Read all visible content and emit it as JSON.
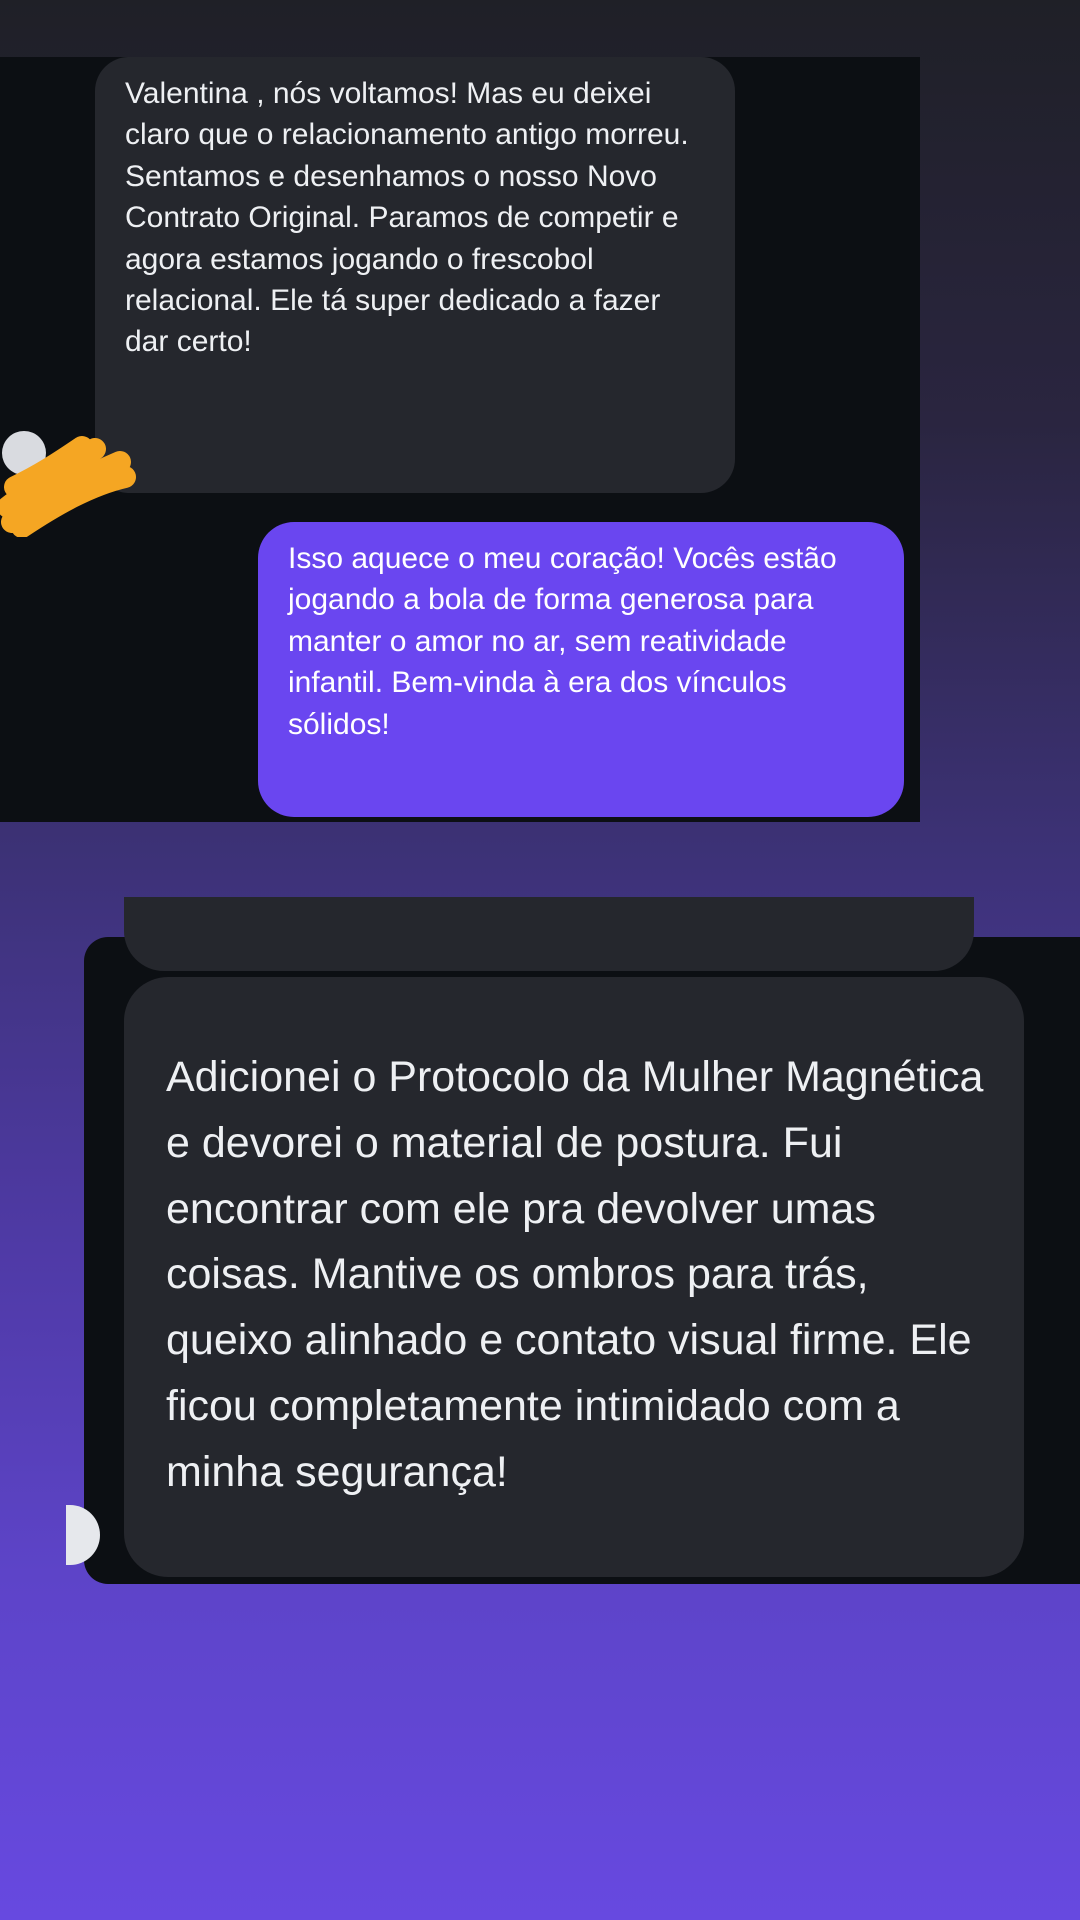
{
  "screenshot_1": {
    "received_message": "Valentina , nós voltamos! Mas eu deixei claro que o relacionamento antigo morreu. Sentamos e desenhamos o nosso Novo Contrato Original. Paramos de competir e agora estamos jogando o frescobol relacional. Ele tá super dedicado a fazer dar certo!",
    "sent_message": "Isso aquece o meu coração! Vocês estão jogando a bola de forma generosa para manter o amor no ar, sem reatividade infantil. Bem-vinda à era dos vínculos sólidos!"
  },
  "screenshot_2": {
    "received_message": "Adicionei o Protocolo da Mulher Magnética e devorei o material de postura. Fui encontrar com ele pra devolver umas coisas. Mantive os ombros para trás, queixo alinhado e contato visual firme. Ele ficou completamente intimidado com a minha segurança!"
  },
  "colors": {
    "received_bubble": "#25272d",
    "sent_bubble": "#6a46f0",
    "chat_background": "#0c0f13",
    "scribble": "#f5a623"
  }
}
